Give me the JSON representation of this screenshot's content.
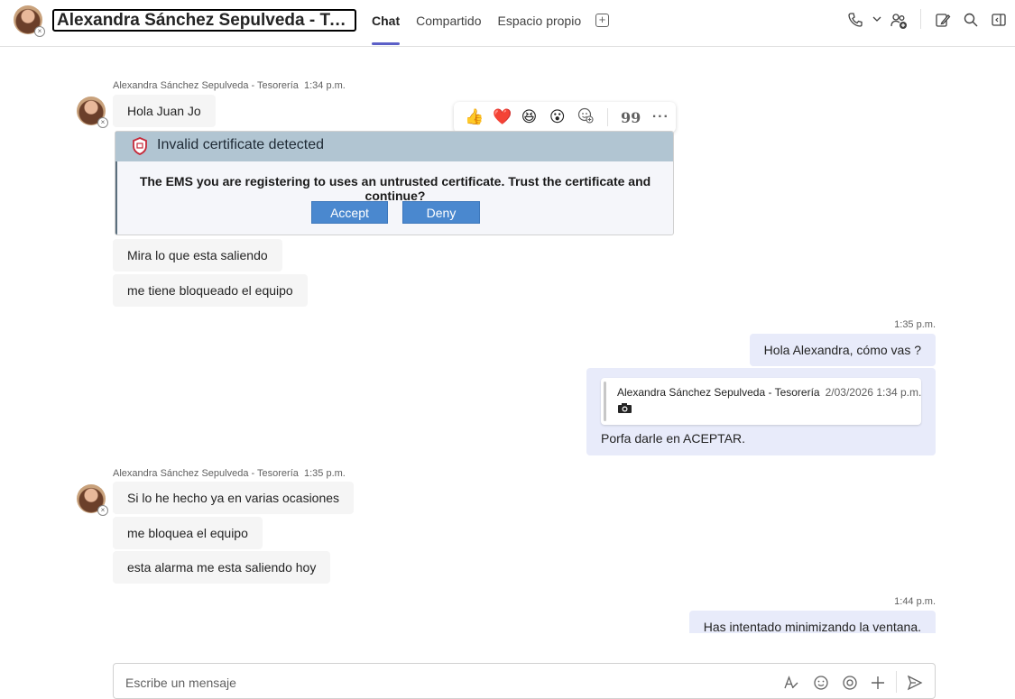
{
  "header": {
    "contact_name": "Alexandra Sánchez Sepulveda - Tesor…",
    "tabs": [
      {
        "label": "Chat",
        "active": true
      },
      {
        "label": "Compartido",
        "active": false
      },
      {
        "label": "Espacio propio",
        "active": false
      }
    ],
    "icons": [
      "add-tab-icon",
      "phone-icon",
      "chevron-down-icon",
      "add-people-icon",
      "pop-out-icon",
      "search-icon",
      "side-panel-icon"
    ]
  },
  "messages": {
    "group1": {
      "author": "Alexandra Sánchez Sepulveda - Tesorería",
      "time": "1:34 p.m.",
      "m1": "Hola Juan Jo",
      "m2": "Mira lo que esta saliendo",
      "m3": "me tiene bloqueado el equipo"
    },
    "image": {
      "title": "Invalid certificate detected",
      "body": "The EMS you are registering to uses an untrusted certificate. Trust the certificate and continue?",
      "accept": "Accept",
      "deny": "Deny"
    },
    "reactions": {
      "emojis": [
        "👍",
        "❤️",
        "😆",
        "😮",
        "add-reaction-icon"
      ],
      "quote_icon": "99",
      "more_icon": "···"
    },
    "mine1": {
      "time": "1:35 p.m.",
      "text": "Hola Alexandra, cómo vas ?"
    },
    "mine2": {
      "quote_author": "Alexandra Sánchez Sepulveda - Tesorería",
      "quote_time": "2/03/2026 1:34 p.m.",
      "text": "Porfa darle en ACEPTAR."
    },
    "group2": {
      "author": "Alexandra Sánchez Sepulveda - Tesorería",
      "time": "1:35 p.m.",
      "m1": "Si lo he hecho ya en varias ocasiones",
      "m2": "me bloquea el equipo",
      "m3": "esta alarma me esta saliendo hoy"
    },
    "mine3": {
      "time": "1:44 p.m.",
      "text": "Has intentado minimizando la ventana."
    }
  },
  "compose": {
    "placeholder": "Escribe un mensaje"
  }
}
